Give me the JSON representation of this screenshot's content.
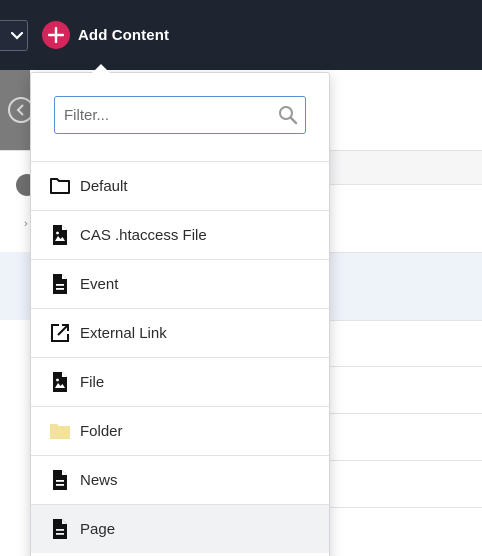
{
  "header": {
    "add_content_label": "Add Content",
    "accent_color": "#d5265b"
  },
  "dropdown": {
    "filter_placeholder": "Filter...",
    "filter_value": "",
    "items": [
      {
        "label": "Default",
        "icon": "folder-outline-icon"
      },
      {
        "label": "CAS .htaccess File",
        "icon": "file-image-icon"
      },
      {
        "label": "Event",
        "icon": "document-icon"
      },
      {
        "label": "External Link",
        "icon": "external-link-icon"
      },
      {
        "label": "File",
        "icon": "file-image-icon"
      },
      {
        "label": "Folder",
        "icon": "folder-filled-icon"
      },
      {
        "label": "News",
        "icon": "document-icon"
      },
      {
        "label": "Page",
        "icon": "document-icon"
      }
    ]
  }
}
